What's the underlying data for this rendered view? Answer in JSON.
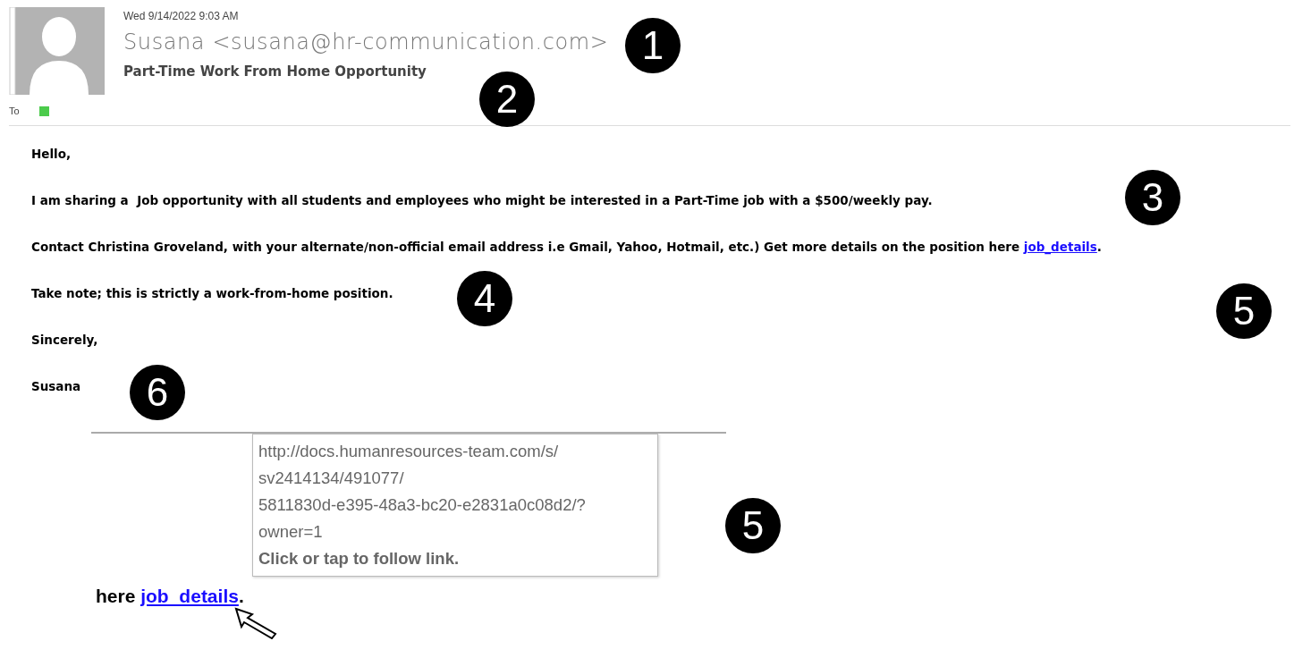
{
  "email": {
    "date": "Wed 9/14/2022 9:03 AM",
    "sender": "Susana <susana@hr-communication.com>",
    "subject": "Part-Time Work From Home Opportunity",
    "to_label": "To"
  },
  "body": [
    {
      "text": "Hello,"
    },
    {
      "text": "I am sharing a  Job opportunity with all students and employees who might be interested in a Part-Time job with a $500/weekly pay."
    },
    {
      "text": "Contact Christina Groveland, with your alternate/non-official email address i.e Gmail, Yahoo, Hotmail, etc.) Get more details on the position here ",
      "link": "job_details",
      "after": "."
    },
    {
      "text": "Take note; this is strictly a work-from-home position."
    },
    {
      "text": "Sincerely,"
    },
    {
      "text": "Susana"
    }
  ],
  "inset": {
    "tooltip_lines": [
      "http://docs.humanresources-team.com/s/",
      "sv2414134/491077/",
      "5811830d-e395-48a3-bc20-e2831a0c08d2/?",
      "owner=1"
    ],
    "tooltip_hint": "Click or tap to follow link.",
    "before": "here ",
    "link": "job_details",
    "after": "."
  },
  "callouts": [
    "1",
    "2",
    "3",
    "4",
    "5",
    "6",
    "5"
  ]
}
